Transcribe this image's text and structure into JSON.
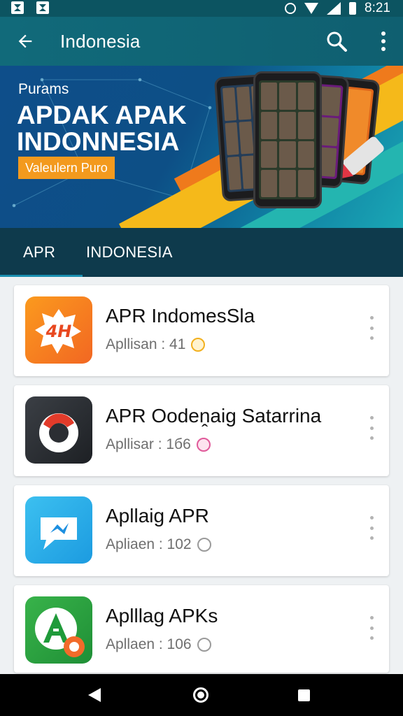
{
  "status_bar": {
    "time": "8:21",
    "icons": [
      "photo-icon",
      "gallery-icon",
      "alarm-icon",
      "wifi-icon",
      "signal-icon",
      "battery-icon"
    ]
  },
  "app_bar": {
    "title": "Indonesia",
    "icons": [
      "back-arrow-icon",
      "search-icon",
      "more-vert-icon"
    ]
  },
  "banner": {
    "kicker": "Purams",
    "headline": "APDAK APAK INDONNESIA",
    "cta_label": "Valeulern Puro"
  },
  "tabs": [
    {
      "label": "APR",
      "active": true
    },
    {
      "label": "INDONESIA",
      "active": false
    }
  ],
  "apps": [
    {
      "name": "APR IndomesSla",
      "meta": "Apllisan : 41",
      "badge_color": "#f2b01e",
      "icon": "app-orange-icon",
      "icon_text": "4H"
    },
    {
      "name": "APR Oodeṋaig Satarrina",
      "meta": "Apllisar : 1б6",
      "badge_color": "#e05a9a",
      "icon": "app-dark-ring-icon",
      "icon_text": ""
    },
    {
      "name": "Apllaig APR",
      "meta": "Apliaen : 102",
      "badge_color": "#9a9a9a",
      "icon": "app-blue-chat-icon",
      "icon_text": ""
    },
    {
      "name": "Aplllag APKs",
      "meta": "Apllaen : 106",
      "badge_color": "#9a9a9a",
      "icon": "app-green-a-icon",
      "icon_text": ""
    }
  ],
  "colors": {
    "app_bar": "#116a7a",
    "tab_bar": "#0e3a4c",
    "accent": "#1a8fb0",
    "cta": "#f39a1e"
  },
  "nav_bar": {
    "icons": [
      "nav-back-icon",
      "nav-home-icon",
      "nav-recents-icon"
    ]
  }
}
